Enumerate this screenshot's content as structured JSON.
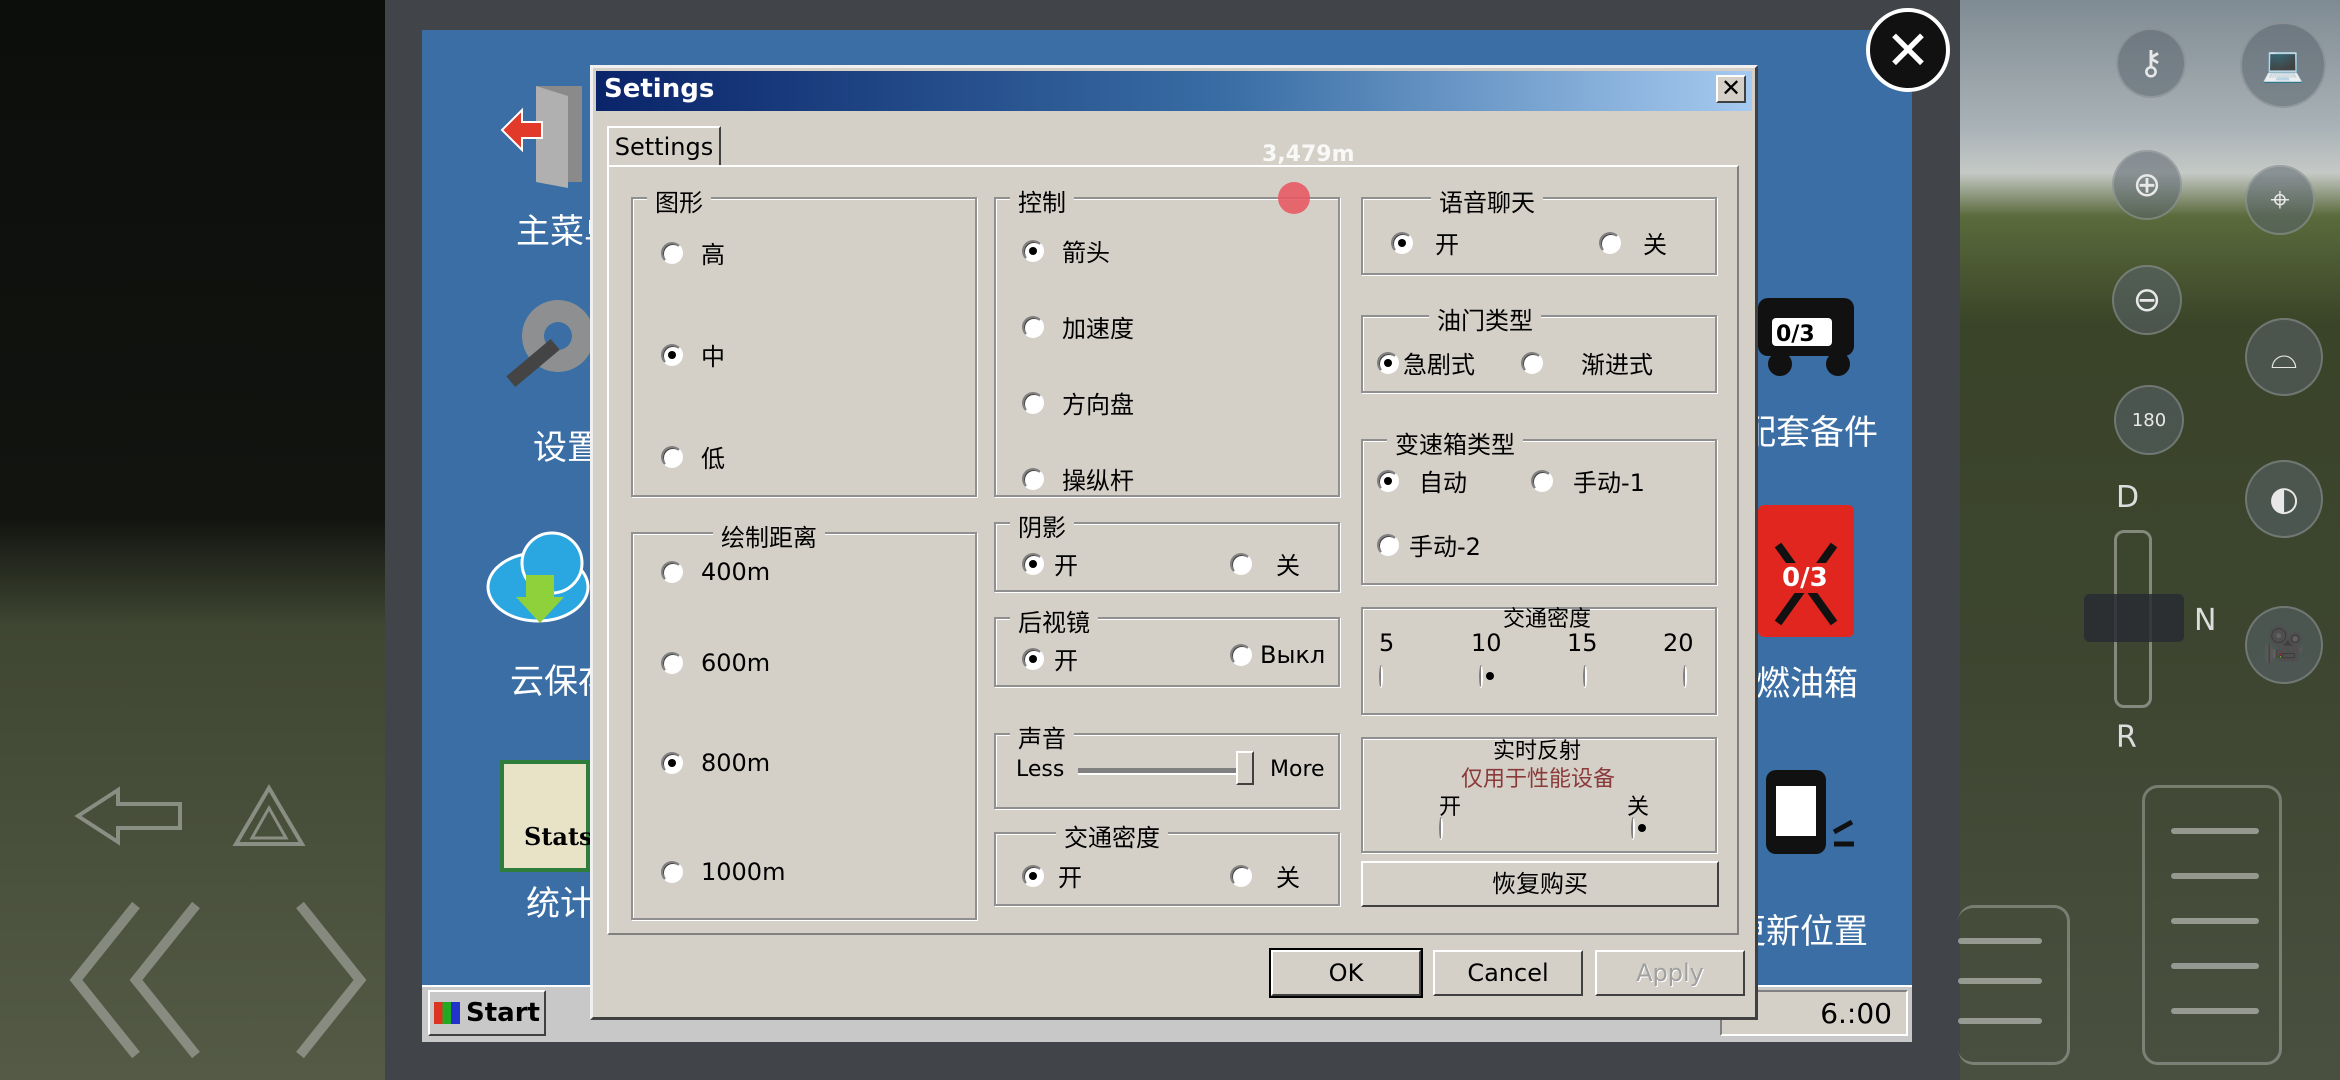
{
  "hud": {
    "distance": "3,479m",
    "clock": "6.:00",
    "start_label": "Start"
  },
  "desktop": {
    "left_icons": [
      "主菜单",
      "设置",
      "云保存",
      "统计"
    ],
    "right_icons": [
      "配套备件",
      "燃油箱",
      "更新位置"
    ],
    "fuel_counter": "0/3",
    "parts_counter": "0/3",
    "stats_label": "Stats"
  },
  "window": {
    "title": "Setings",
    "tab": "Settings",
    "graphics": {
      "label": "图形",
      "options": [
        "高",
        "中",
        "低"
      ],
      "selected": "中"
    },
    "draw_distance": {
      "label": "绘制距离",
      "options": [
        "400m",
        "600m",
        "800m",
        "1000m"
      ],
      "selected": "800m"
    },
    "control": {
      "label": "控制",
      "options": [
        "箭头",
        "加速度",
        "方向盘",
        "操纵杆"
      ],
      "selected": "箭头"
    },
    "shadows": {
      "label": "阴影",
      "on": "开",
      "off": "关",
      "selected": "开"
    },
    "mirrors": {
      "label": "后视镜",
      "on": "开",
      "off": "Выкл",
      "selected": "开"
    },
    "sound": {
      "label": "声音",
      "less": "Less",
      "more": "More",
      "level": 0.95
    },
    "traffic_toggle": {
      "label": "交通密度",
      "on": "开",
      "off": "关",
      "selected": "开"
    },
    "voice_chat": {
      "label": "语音聊天",
      "on": "开",
      "off": "关",
      "selected": "开"
    },
    "throttle": {
      "label": "油门类型",
      "options": [
        "急剧式",
        "渐进式"
      ],
      "selected": "急剧式"
    },
    "gearbox": {
      "label": "变速箱类型",
      "options": [
        "自动",
        "手动-1",
        "手动-2"
      ],
      "selected": "自动"
    },
    "traffic_density": {
      "label": "交通密度",
      "values": [
        "5",
        "10",
        "15",
        "20"
      ],
      "selected": "10"
    },
    "reflections": {
      "label": "实时反射",
      "note": "仅用于性能设备",
      "on": "开",
      "off": "关",
      "selected": "关"
    },
    "restore_button": "恢复购买",
    "ok_button": "OK",
    "cancel_button": "Cancel",
    "apply_button": "Apply"
  },
  "controls": {
    "gear_d": "D",
    "gear_n": "N",
    "gear_r": "R",
    "rotate_label": "180"
  },
  "colors": {
    "desktop": "#3a6ea5",
    "window": "#d4d0c8",
    "title_start": "#0a246a",
    "fuel_can": "#e0261f"
  }
}
